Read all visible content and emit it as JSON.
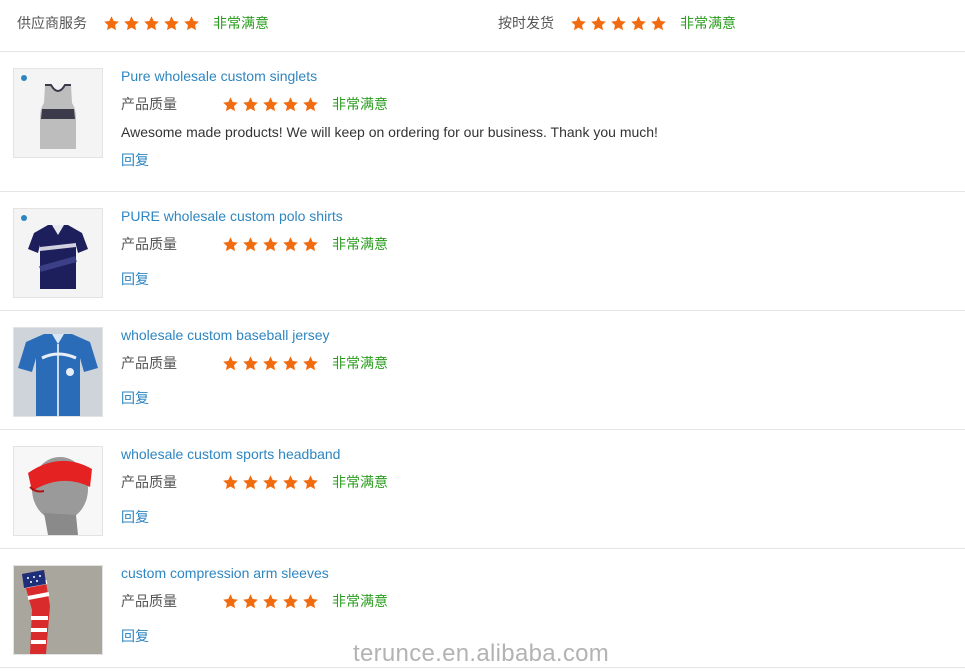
{
  "summary": {
    "service_label": "供应商服务",
    "service_rating": 5,
    "service_text": "非常满意",
    "delivery_label": "按时发货",
    "delivery_rating": 5,
    "delivery_text": "非常满意"
  },
  "reviews": [
    {
      "title": "Pure wholesale custom singlets",
      "quality_label": "产品质量",
      "rating": 5,
      "rating_text": "非常满意",
      "comment": "Awesome made products! We will keep on ordering for our business. Thank you much!",
      "reply": "回复",
      "image": "singlet-image"
    },
    {
      "title": "PURE wholesale custom polo shirts",
      "quality_label": "产品质量",
      "rating": 5,
      "rating_text": "非常满意",
      "comment": "",
      "reply": "回复",
      "image": "polo-shirt-image"
    },
    {
      "title": "wholesale custom baseball jersey",
      "quality_label": "产品质量",
      "rating": 5,
      "rating_text": "非常满意",
      "comment": "",
      "reply": "回复",
      "image": "baseball-jersey-image"
    },
    {
      "title": "wholesale custom sports headband",
      "quality_label": "产品质量",
      "rating": 5,
      "rating_text": "非常满意",
      "comment": "",
      "reply": "回复",
      "image": "headband-image"
    },
    {
      "title": "custom compression arm sleeves",
      "quality_label": "产品质量",
      "rating": 5,
      "rating_text": "非常满意",
      "comment": "",
      "reply": "回复",
      "image": "arm-sleeve-image"
    }
  ],
  "watermark": "terunce.en.alibaba.com",
  "colors": {
    "star": "#f26b0f",
    "link": "#2e86c1",
    "satisfied": "#2a9d1e"
  }
}
